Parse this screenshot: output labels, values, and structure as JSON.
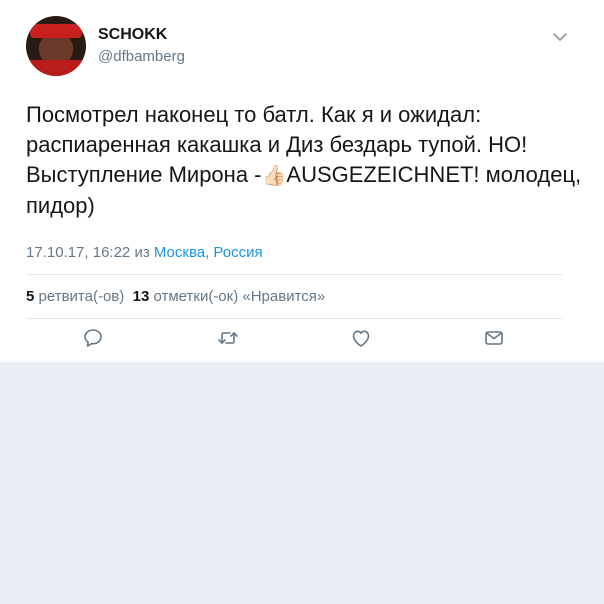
{
  "user": {
    "name": "SCHOKK",
    "handle": "@dfbamberg"
  },
  "tweet": {
    "text_part1": "Посмотрел наконец то батл. Как я и ожидал: распиаренная какашка и Диз бездарь тупой. НО! Выступление Мирона -",
    "emoji": "👍🏻",
    "text_part2": "AUSGEZEICHNET! молодец, пидор)",
    "datetime": "17.10.17, 16:22",
    "from_word": "из",
    "location": "Москва, Россия"
  },
  "stats": {
    "retweets_count": "5",
    "retweets_label": "ретвита(-ов)",
    "likes_count": "13",
    "likes_label": "отметки(-ок) «Нравится»"
  },
  "icons": {
    "reply": "reply-icon",
    "retweet": "retweet-icon",
    "like": "heart-icon",
    "dm": "envelope-icon",
    "menu": "chevron-down-icon"
  },
  "colors": {
    "link": "#1b95e0",
    "secondary": "#657786",
    "background": "#e8ecf3"
  }
}
